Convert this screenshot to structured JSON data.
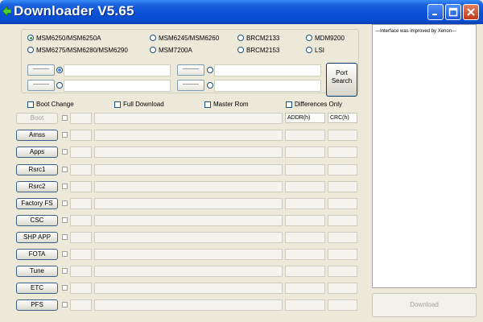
{
  "window": {
    "title": "Downloader V5.65"
  },
  "chipsets": [
    {
      "label": "MSM6250/MSM6250A",
      "selected": true
    },
    {
      "label": "MSM6245/MSM6260",
      "selected": false
    },
    {
      "label": "BRCM2133",
      "selected": false
    },
    {
      "label": "MDM9200",
      "selected": false
    },
    {
      "label": "MSM6275/MSM6280/MSM6290",
      "selected": false
    },
    {
      "label": "MSM7200A",
      "selected": false
    },
    {
      "label": "BRCM2153",
      "selected": false
    },
    {
      "label": "LSI",
      "selected": false
    }
  ],
  "ports": [
    {
      "button": "----------",
      "value": ""
    },
    {
      "button": "----------",
      "value": ""
    },
    {
      "button": "----------",
      "value": ""
    },
    {
      "button": "----------",
      "value": ""
    }
  ],
  "port_search": {
    "line1": "Port",
    "line2": "Search"
  },
  "options": {
    "boot_change": "Boot Change",
    "full_download": "Full Download",
    "master_rom": "Master Rom",
    "differences_only": "Differences Only"
  },
  "columns": {
    "addr": "ADDR(h)",
    "crc": "CRC(h)"
  },
  "rows": [
    {
      "label": "Boot",
      "enabled": false
    },
    {
      "label": "Amss",
      "enabled": true
    },
    {
      "label": "Apps",
      "enabled": true
    },
    {
      "label": "Rsrc1",
      "enabled": true
    },
    {
      "label": "Rsrc2",
      "enabled": true
    },
    {
      "label": "Factory FS",
      "enabled": true
    },
    {
      "label": "CSC",
      "enabled": true
    },
    {
      "label": "SHP APP",
      "enabled": true
    },
    {
      "label": "FOTA",
      "enabled": true
    },
    {
      "label": "Tune",
      "enabled": true
    },
    {
      "label": "ETC",
      "enabled": true
    },
    {
      "label": "PFS",
      "enabled": true
    }
  ],
  "log": {
    "text": "---Interface was improved by Xenon---"
  },
  "download_button": "Download",
  "icons": {
    "title": "green-arrow-icon",
    "minimize": "minimize-icon",
    "maximize": "maximize-icon",
    "close": "close-icon"
  }
}
